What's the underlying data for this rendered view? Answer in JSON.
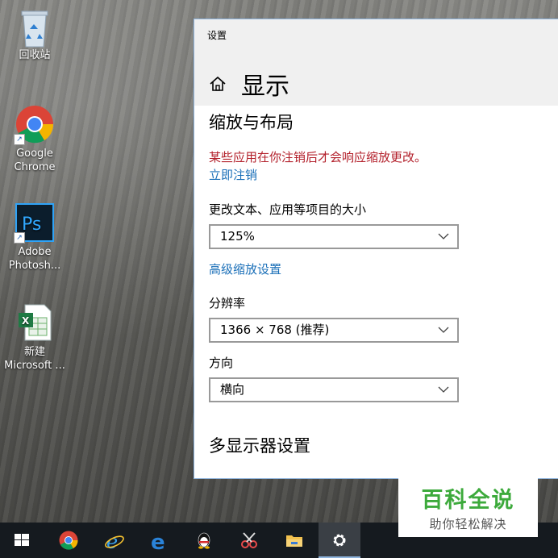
{
  "desktop": {
    "icons": [
      {
        "label": "回收站"
      },
      {
        "label": "Google Chrome"
      },
      {
        "label": "Adobe Photosh..."
      },
      {
        "label": "新建 Microsoft ..."
      }
    ]
  },
  "window": {
    "title": "设置",
    "page_title": "显示",
    "section_title": "缩放与布局",
    "warning": "某些应用在你注销后才会响应缩放更改。",
    "signout_link": "立即注销",
    "scale_label": "更改文本、应用等项目的大小",
    "scale_value": "125%",
    "advanced_link": "高级缩放设置",
    "resolution_label": "分辨率",
    "resolution_value": "1366 × 768 (推荐)",
    "orientation_label": "方向",
    "orientation_value": "横向",
    "multi_display_title": "多显示器设置"
  },
  "watermark": {
    "title": "百科全说",
    "subtitle": "助你轻松解决"
  },
  "colors": {
    "warning": "#b3202b",
    "link": "#1a6fb8",
    "taskbar": "#151a1f",
    "watermark_green": "#3daa3c"
  }
}
